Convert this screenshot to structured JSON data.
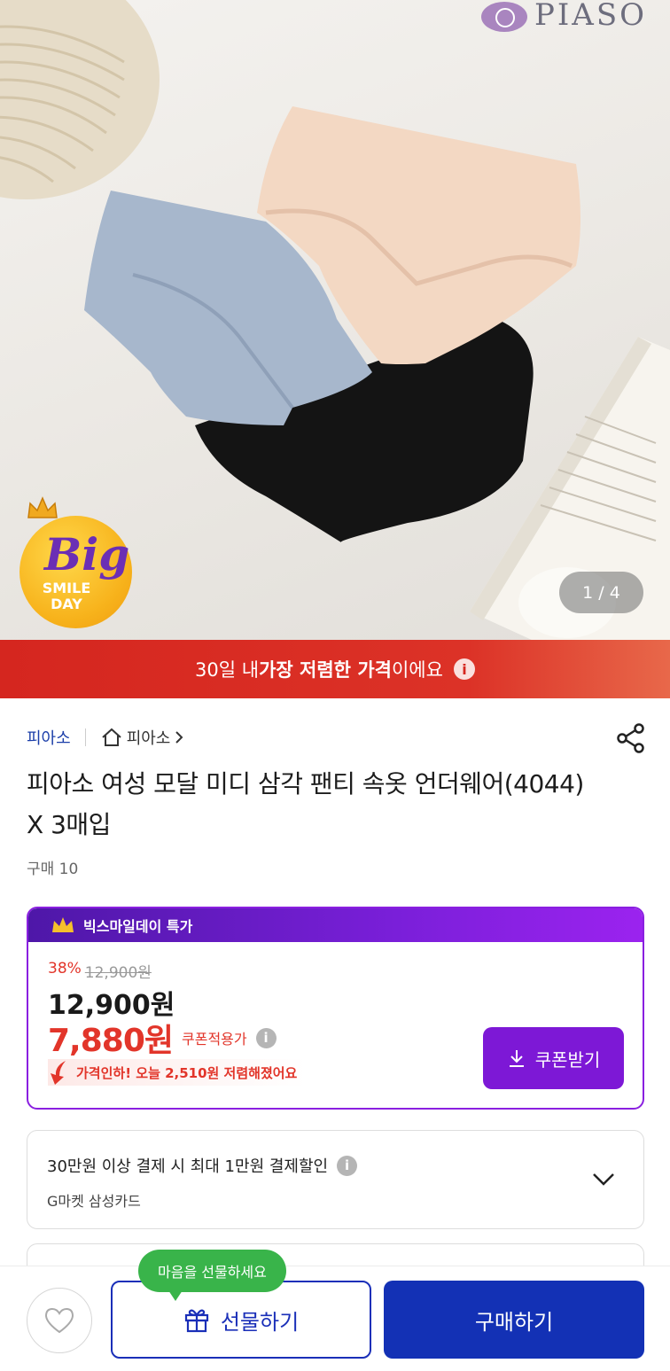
{
  "hero": {
    "brand_name": "PIASO",
    "badge": {
      "line1": "Big",
      "line2": "SMILE",
      "line3": "DAY"
    },
    "page_indicator": "1 / 4"
  },
  "banner": {
    "prefix": "30일 내 ",
    "highlight": "가장 저렴한 가격",
    "suffix": "이에요",
    "icon": "info-icon"
  },
  "seller": {
    "name": "피아소",
    "store_label": "피아소",
    "store_icon": "home-icon"
  },
  "product": {
    "title": "피아소 여성 모달 미디 삼각 팬티 속옷 언더웨어(4044) X 3매입",
    "purchase_count": "구매 10"
  },
  "price_card": {
    "header": "빅스마일데이 특가",
    "discount_rate": "38%",
    "original_price": "12,900원",
    "price": "12,900원",
    "coupon_price": "7,880원",
    "coupon_note": "쿠폰적용가",
    "price_drop_note": "가격인하! 오늘 2,510원 저렴해졌어요",
    "coupon_button": "쿠폰받기"
  },
  "card_promo": {
    "line1": "30만원 이상 결제 시 최대 1만원 결제할인",
    "line2": "G마켓 삼성카드"
  },
  "bottom_bar": {
    "tooltip": "마음을 선물하세요",
    "gift_button": "선물하기",
    "buy_button": "구매하기"
  },
  "colors": {
    "banner_red": "#d5261f",
    "accent_purple": "#7d18d6",
    "buy_blue": "#1331b5",
    "tooltip_green": "#39b44a"
  }
}
